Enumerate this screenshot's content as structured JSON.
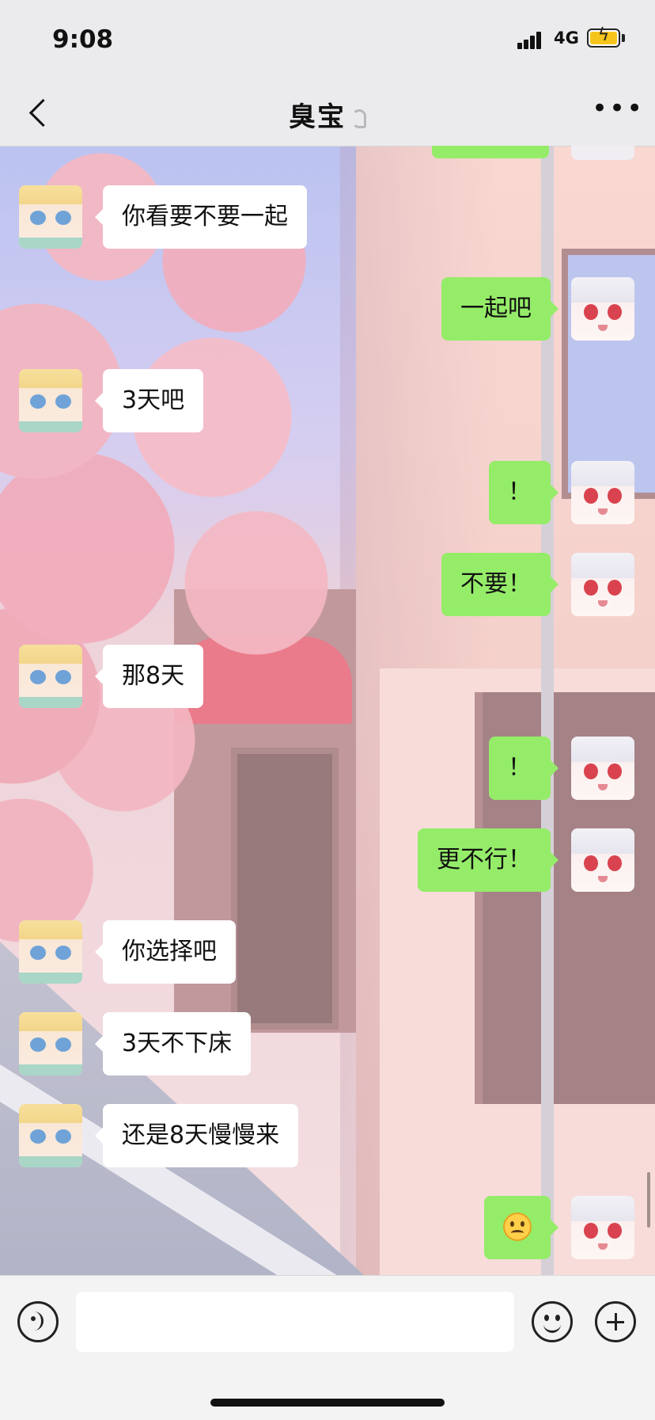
{
  "status": {
    "time": "9:08",
    "network": "4G"
  },
  "nav": {
    "title": "臭宝"
  },
  "messages": [
    {
      "side": "left",
      "text": "你看要不要一起"
    },
    {
      "side": "right",
      "text": "一起吧"
    },
    {
      "side": "left",
      "text": "3天吧"
    },
    {
      "side": "right",
      "text": "！"
    },
    {
      "side": "right",
      "text": "不要！"
    },
    {
      "side": "left",
      "text": "那8天"
    },
    {
      "side": "right",
      "text": "！"
    },
    {
      "side": "right",
      "text": "更不行！"
    },
    {
      "side": "left",
      "text": "你选择吧"
    },
    {
      "side": "left",
      "text": "3天不下床"
    },
    {
      "side": "left",
      "text": "还是8天慢慢来"
    },
    {
      "side": "right",
      "emoji": "frowning-face-emoji"
    }
  ],
  "input": {
    "value": ""
  },
  "colors": {
    "sent_bubble": "#95ec69",
    "received_bubble": "#ffffff",
    "bar_bg": "#ebebee"
  },
  "icons": {
    "back": "back-chevron-icon",
    "title_suffix": "ear-icon",
    "more": "more-dots-icon",
    "voice": "voice-icon",
    "sticker": "smiley-icon",
    "add": "plus-icon"
  }
}
